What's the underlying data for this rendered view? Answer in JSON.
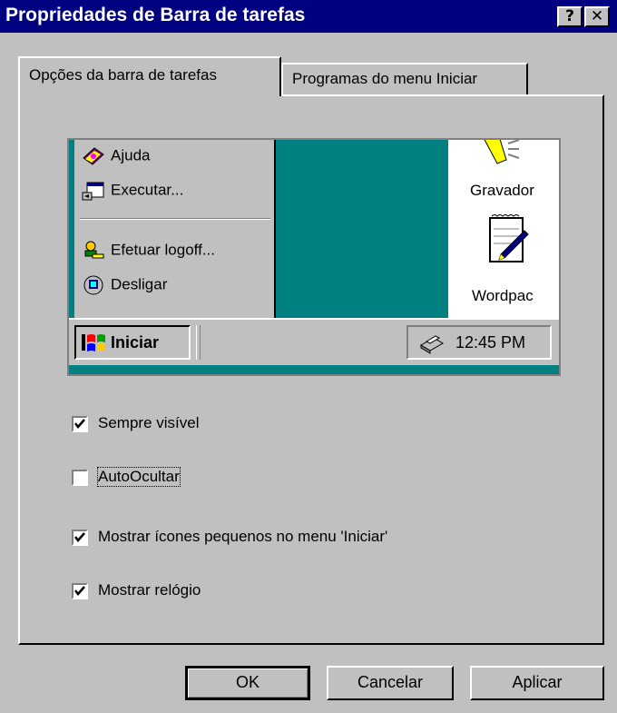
{
  "window": {
    "title": "Propriedades de Barra de tarefas",
    "help_button": "?",
    "close_button": "✕"
  },
  "tabs": [
    {
      "label": "Opções da barra de tarefas",
      "active": true
    },
    {
      "label": "Programas do menu Iniciar",
      "active": false
    }
  ],
  "preview": {
    "start_menu_items": [
      {
        "label": "Ajuda",
        "icon": "help-book-icon"
      },
      {
        "label": "Executar...",
        "icon": "run-icon"
      },
      {
        "label": "Efetuar logoff...",
        "icon": "logoff-key-icon"
      },
      {
        "label": "Desligar",
        "icon": "shutdown-computer-icon"
      }
    ],
    "desktop_icons": [
      {
        "label": "Gravador",
        "icon": "sound-recorder-icon"
      },
      {
        "label": "Wordpac",
        "icon": "wordpad-notepad-icon"
      }
    ],
    "start_button": "Iniciar",
    "clock": "12:45 PM"
  },
  "options": [
    {
      "label": "Sempre visível",
      "checked": true
    },
    {
      "label": "AutoOcultar",
      "checked": false
    },
    {
      "label": "Mostrar ícones pequenos no menu 'Iniciar'",
      "checked": true
    },
    {
      "label": "Mostrar relógio",
      "checked": true
    }
  ],
  "buttons": {
    "ok": "OK",
    "cancel": "Cancelar",
    "apply": "Aplicar"
  }
}
